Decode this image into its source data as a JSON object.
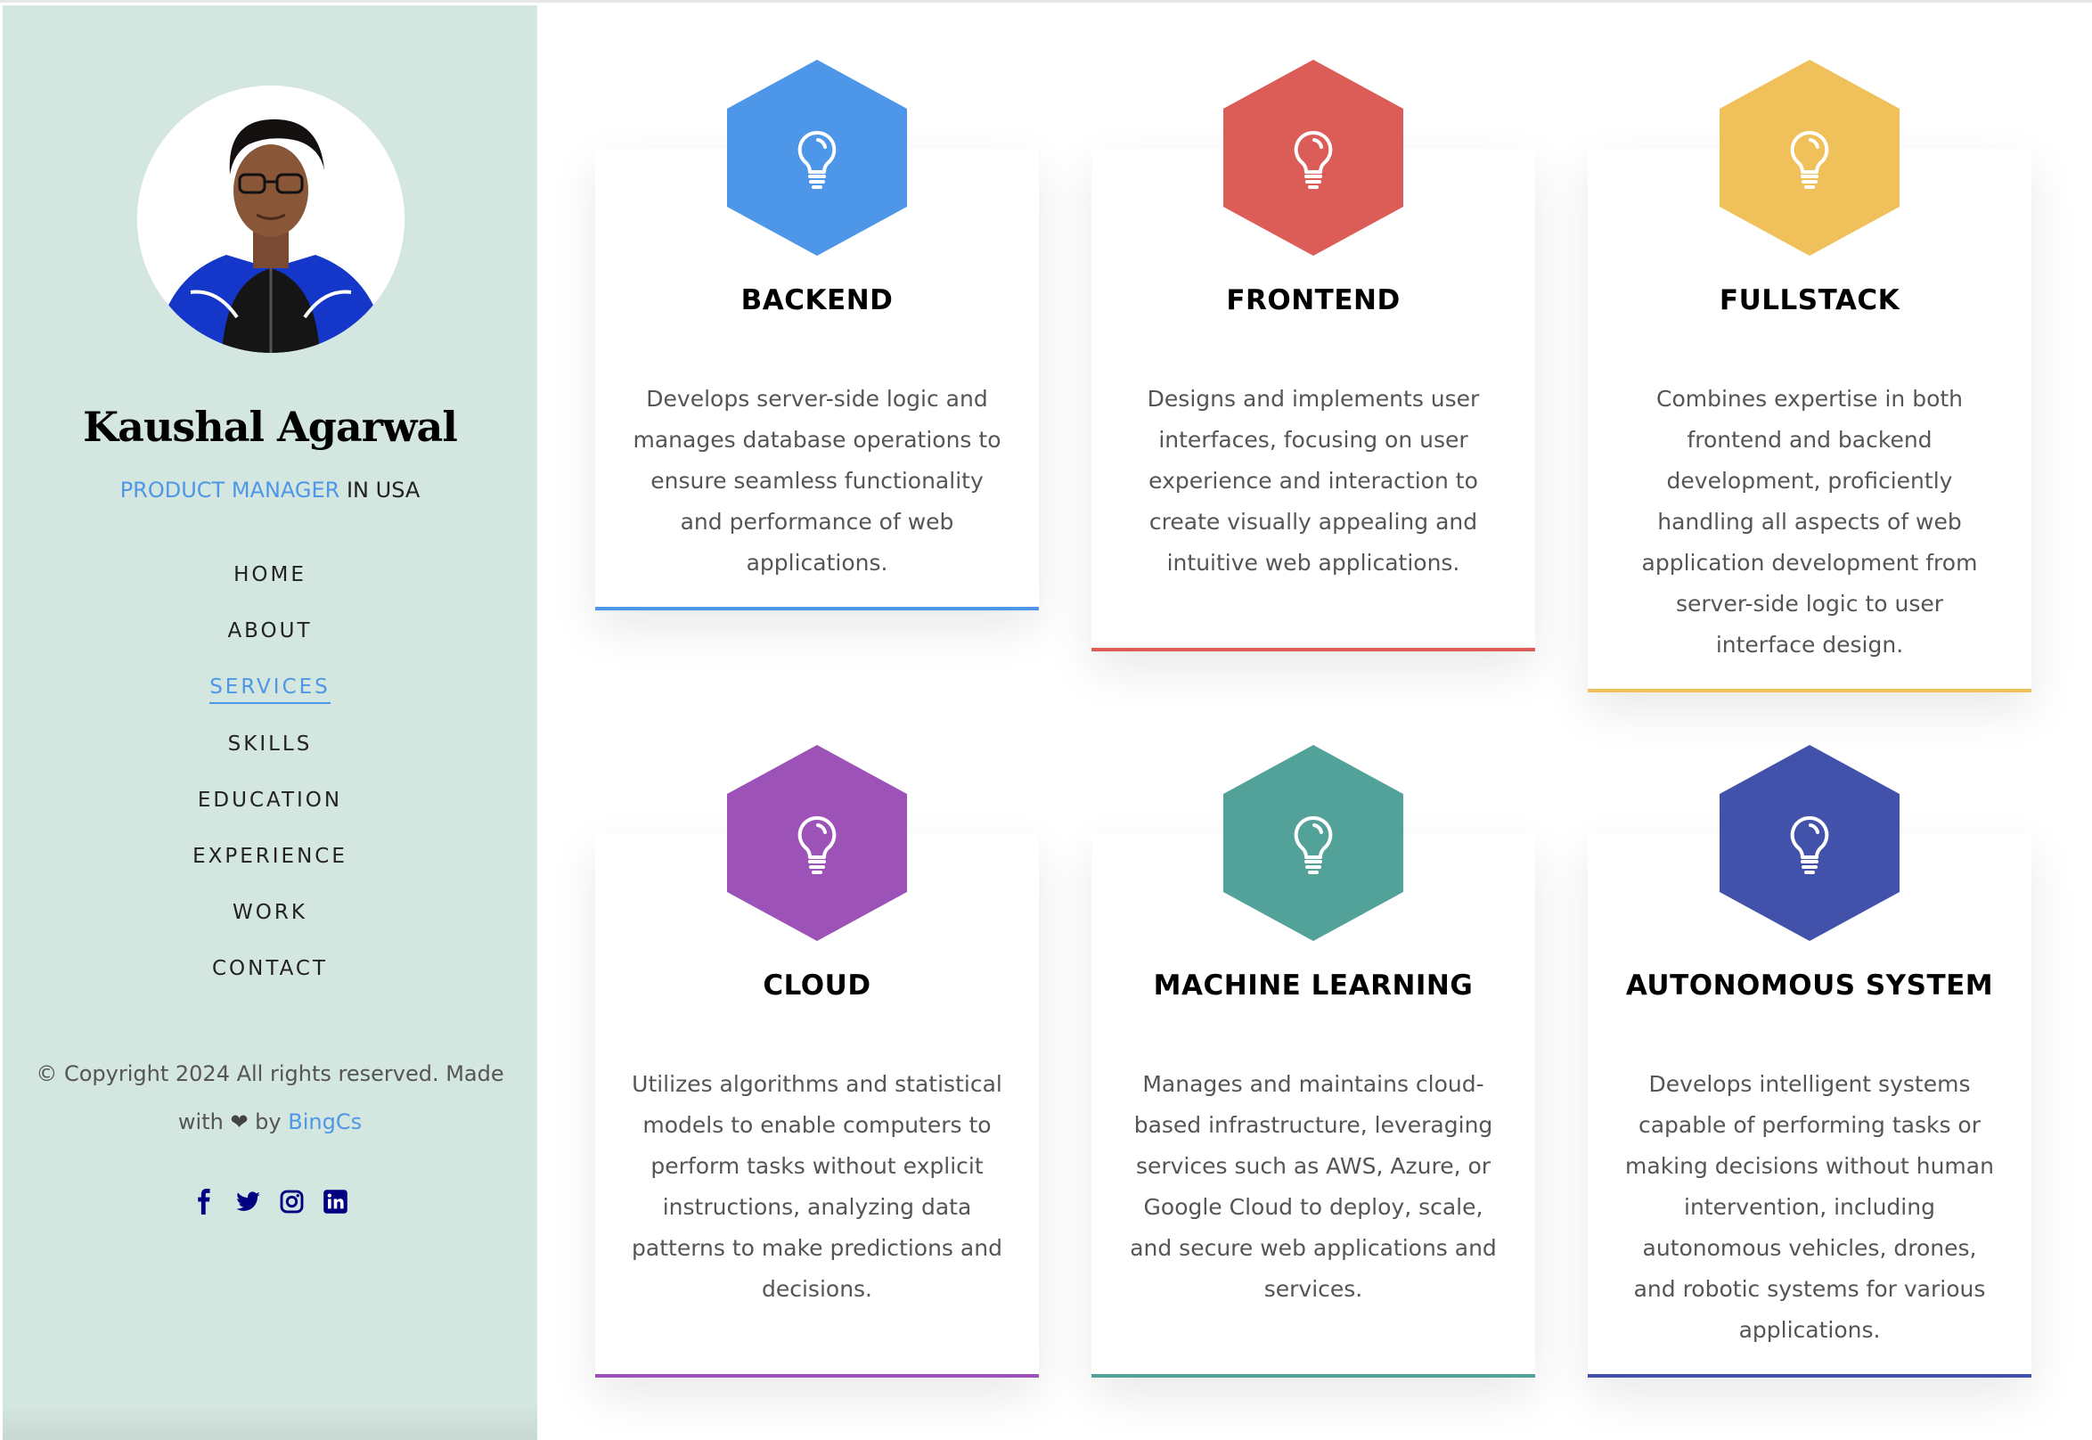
{
  "profile": {
    "name": "Kaushal Agarwal",
    "role_highlight": "PRODUCT MANAGER",
    "role_rest": " IN USA"
  },
  "nav": [
    {
      "label": "HOME"
    },
    {
      "label": "ABOUT"
    },
    {
      "label": "SERVICES",
      "active": true
    },
    {
      "label": "SKILLS"
    },
    {
      "label": "EDUCATION"
    },
    {
      "label": "EXPERIENCE"
    },
    {
      "label": "WORK"
    },
    {
      "label": "CONTACT"
    }
  ],
  "footer": {
    "copyright": "© Copyright 2024 All rights reserved. Made",
    "with": "with ",
    "heart": "❤",
    "by": " by ",
    "author": "BingCs"
  },
  "social": [
    "facebook-icon",
    "twitter-icon",
    "instagram-icon",
    "linkedin-icon"
  ],
  "services": [
    {
      "title": "BACKEND",
      "color": "#4d96e8",
      "description": "Develops server-side logic and manages database operations to ensure seamless functionality and performance of web applications."
    },
    {
      "title": "FRONTEND",
      "color": "#dc5d57",
      "description": "Designs and implements user interfaces, focusing on user experience and interaction to create visually appealing and intuitive web applications."
    },
    {
      "title": "FULLSTACK",
      "color": "#f0c15a",
      "description": "Combines expertise in both frontend and backend development, proficiently handling all aspects of web application development from server-side logic to user interface design."
    },
    {
      "title": "CLOUD",
      "color": "#9c52b6",
      "description": "Utilizes algorithms and statistical models to enable computers to perform tasks without explicit instructions, analyzing data patterns to make predictions and decisions."
    },
    {
      "title": "MACHINE LEARNING",
      "color": "#52a29a",
      "description": "Manages and maintains cloud-based infrastructure, leveraging services such as AWS, Azure, or Google Cloud to deploy, scale, and secure web applications and services."
    },
    {
      "title": "AUTONOMOUS SYSTEM",
      "color": "#4252ab",
      "description": "Develops intelligent systems capable of performing tasks or making decisions without human intervention, including autonomous vehicles, drones, and robotic systems for various applications."
    }
  ]
}
